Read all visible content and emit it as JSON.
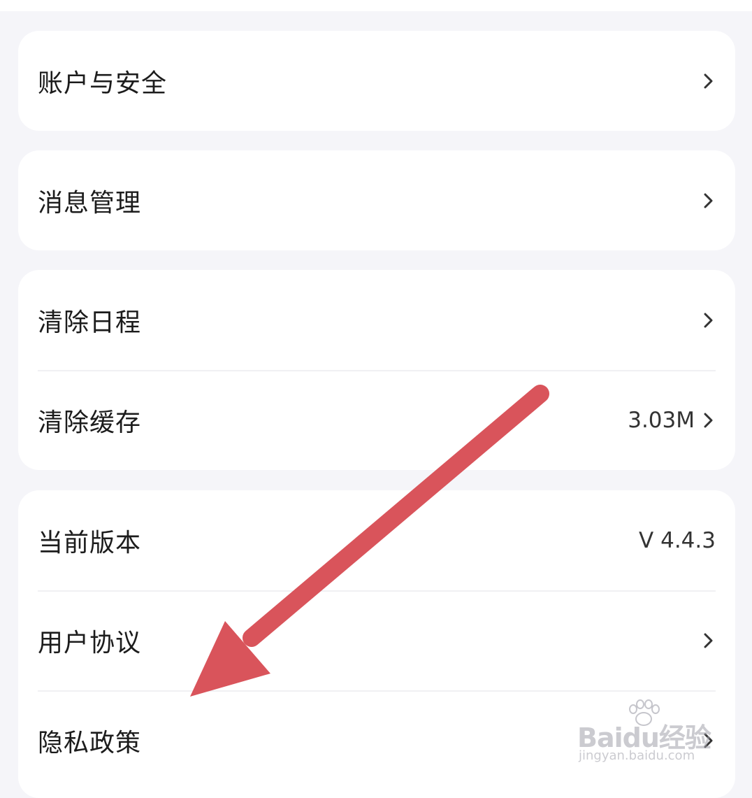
{
  "settings": {
    "account_security": "账户与安全",
    "message_management": "消息管理",
    "clear_schedule": "清除日程",
    "clear_cache": "清除缓存",
    "cache_size": "3.03M",
    "current_version": "当前版本",
    "version_value": "V 4.4.3",
    "user_agreement": "用户协议",
    "privacy_policy": "隐私政策"
  },
  "watermark": {
    "brand": "Baidu经验",
    "url": "jingyan.baidu.com"
  },
  "colors": {
    "background": "#f5f5f9",
    "card": "#ffffff",
    "arrow": "#d9545b",
    "chevron": "#333333"
  },
  "icons": {
    "chevron": "chevron-right-icon",
    "annotation": "red-arrow-annotation"
  }
}
